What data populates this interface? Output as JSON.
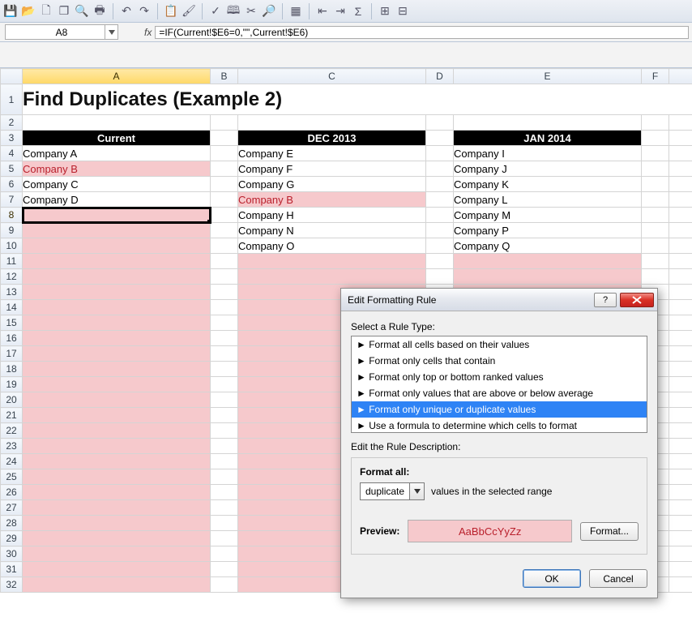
{
  "toolbar": {
    "icons": [
      "save",
      "open",
      "new",
      "copy",
      "print-preview",
      "print",
      "undo",
      "redo",
      "paste-special",
      "paint-format",
      "spellcheck",
      "research",
      "cut",
      "find",
      "table",
      "outline-left",
      "outline-right",
      "subtotal",
      "group",
      "ungroup"
    ]
  },
  "namebox": {
    "value": "A8"
  },
  "formula": {
    "fx": "fx",
    "value": "=IF(Current!$E6=0,\"\",Current!$E6)"
  },
  "columns": [
    "A",
    "B",
    "C",
    "D",
    "E",
    "F"
  ],
  "row_numbers": [
    1,
    2,
    3,
    4,
    5,
    6,
    7,
    8,
    9,
    10,
    11,
    12,
    13,
    14,
    15,
    16,
    17,
    18,
    19,
    20,
    21,
    22,
    23,
    24,
    25,
    26,
    27,
    28,
    29,
    30,
    31,
    32
  ],
  "title": "Find Duplicates (Example 2)",
  "headers": {
    "A": "Current",
    "C": "DEC 2013",
    "E": "JAN 2014"
  },
  "data": {
    "A": [
      "Company A",
      "Company B",
      "Company C",
      "Company D"
    ],
    "C": [
      "Company E",
      "Company F",
      "Company G",
      "Company B",
      "Company H",
      "Company N",
      "Company O"
    ],
    "E": [
      "Company I",
      "Company J",
      "Company K",
      "Company L",
      "Company M",
      "Company P",
      "Company Q"
    ]
  },
  "highlight": {
    "A_dup_row": 5,
    "C_dup_row": 7
  },
  "dialog": {
    "title": "Edit Formatting Rule",
    "select_label": "Select a Rule Type:",
    "rules": [
      "Format all cells based on their values",
      "Format only cells that contain",
      "Format only top or bottom ranked values",
      "Format only values that are above or below average",
      "Format only unique or duplicate values",
      "Use a formula to determine which cells to format"
    ],
    "selected_rule_index": 4,
    "desc_label": "Edit the Rule Description:",
    "format_all_label": "Format all:",
    "combo_value": "duplicate",
    "combo_suffix": "values in the selected range",
    "preview_label": "Preview:",
    "preview_text": "AaBbCcYyZz",
    "format_btn": "Format...",
    "ok": "OK",
    "cancel": "Cancel"
  }
}
